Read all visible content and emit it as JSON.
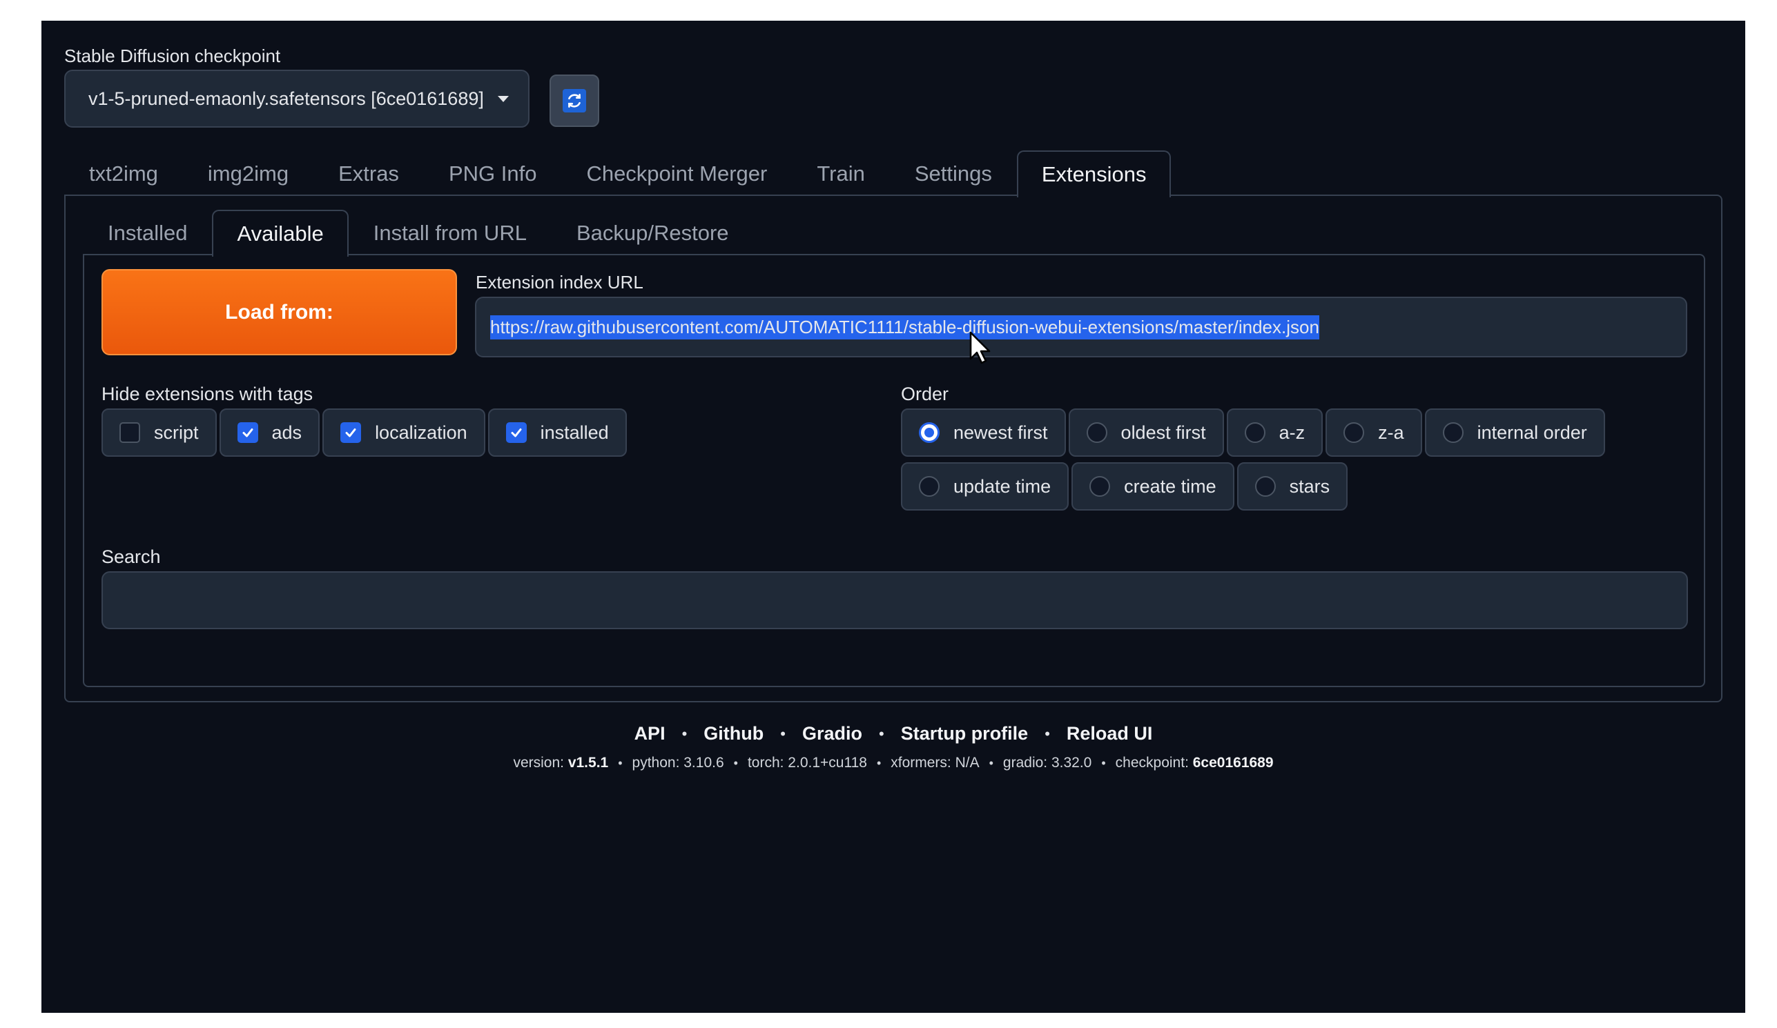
{
  "checkpoint": {
    "label": "Stable Diffusion checkpoint",
    "value": "v1-5-pruned-emaonly.safetensors [6ce0161689]"
  },
  "main_tabs": [
    {
      "label": "txt2img"
    },
    {
      "label": "img2img"
    },
    {
      "label": "Extras"
    },
    {
      "label": "PNG Info"
    },
    {
      "label": "Checkpoint Merger"
    },
    {
      "label": "Train"
    },
    {
      "label": "Settings"
    },
    {
      "label": "Extensions",
      "active": true
    }
  ],
  "sub_tabs": [
    {
      "label": "Installed"
    },
    {
      "label": "Available",
      "active": true
    },
    {
      "label": "Install from URL"
    },
    {
      "label": "Backup/Restore"
    }
  ],
  "available": {
    "load_button": "Load from:",
    "url_label": "Extension index URL",
    "url_value": "https://raw.githubusercontent.com/AUTOMATIC1111/stable-diffusion-webui-extensions/master/index.json",
    "hide_label": "Hide extensions with tags",
    "tags": [
      {
        "label": "script",
        "checked": false
      },
      {
        "label": "ads",
        "checked": true
      },
      {
        "label": "localization",
        "checked": true
      },
      {
        "label": "installed",
        "checked": true
      }
    ],
    "order_label": "Order",
    "order_options_row1": [
      {
        "label": "newest first",
        "selected": true
      },
      {
        "label": "oldest first",
        "selected": false
      },
      {
        "label": "a-z",
        "selected": false
      },
      {
        "label": "z-a",
        "selected": false
      },
      {
        "label": "internal order",
        "selected": false
      }
    ],
    "order_options_row2": [
      {
        "label": "update time",
        "selected": false
      },
      {
        "label": "create time",
        "selected": false
      },
      {
        "label": "stars",
        "selected": false
      }
    ],
    "search_label": "Search",
    "search_value": ""
  },
  "footer": {
    "links": [
      "API",
      "Github",
      "Gradio",
      "Startup profile",
      "Reload UI"
    ],
    "version_label": "version:",
    "version_value": "v1.5.1",
    "python": "python: 3.10.6",
    "torch": "torch: 2.0.1+cu118",
    "xformers": "xformers: N/A",
    "gradio": "gradio: 3.32.0",
    "checkpoint_label": "checkpoint:",
    "checkpoint_value": "6ce0161689"
  },
  "colors": {
    "background": "#0b0f19",
    "accent_orange": "#ea580c",
    "accent_blue": "#2563eb"
  }
}
